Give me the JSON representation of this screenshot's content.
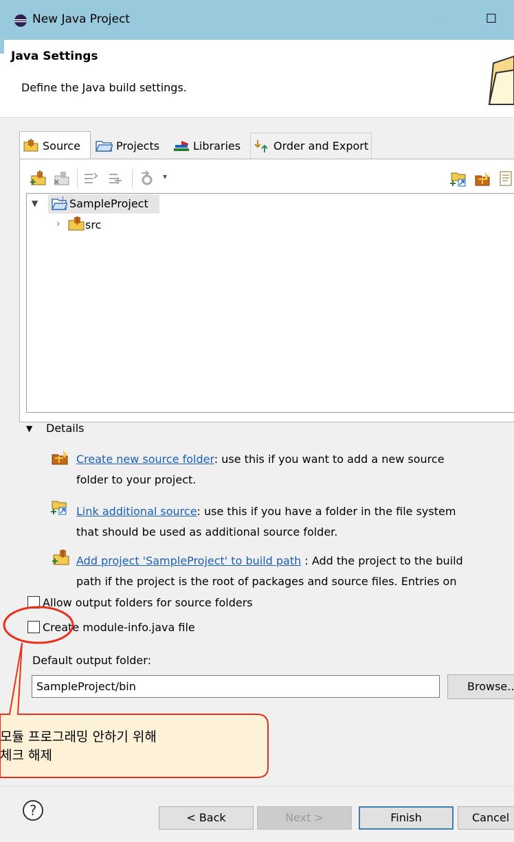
{
  "window": {
    "title": "New Java Project",
    "minimize": "—",
    "maximize": "☐"
  },
  "header": {
    "title": "Java Settings",
    "description": "Define the Java build settings."
  },
  "tabs": [
    {
      "label": "Source",
      "selected": true
    },
    {
      "label": "Projects",
      "selected": false
    },
    {
      "label": "Libraries",
      "selected": false
    },
    {
      "label": "Order and Export",
      "selected": false
    }
  ],
  "tree": {
    "project": "SampleProject",
    "child": "src"
  },
  "details": {
    "label": "Details",
    "items": [
      {
        "link": "Create new source folder",
        "text_1": ": use this if you want to add a new source",
        "text_2": "folder to your project."
      },
      {
        "link": "Link additional source",
        "text_1": ": use this if you have a folder in the file system",
        "text_2": "that should be used as additional source folder."
      },
      {
        "link": "Add project 'SampleProject' to build path",
        "text_1": " : Add the project to the build",
        "text_2": "path if the project is the root of packages and source files. Entries on"
      }
    ]
  },
  "options": {
    "allow_output": "Allow output folders for source folders",
    "module_info": "Create module-info.java file"
  },
  "output": {
    "label": "Default output folder:",
    "value": "SampleProject/bin",
    "browse": "Browse..."
  },
  "buttons": {
    "back": "< Back",
    "next": "Next >",
    "finish": "Finish",
    "cancel": "Cancel"
  },
  "callout": {
    "line1": "모듈 프로그래밍 안하기 위해",
    "line2": "체크 해제"
  },
  "colors": {
    "titlebar": "#99c9dd",
    "link": "#1a5fb4",
    "annotation": "#e8301c",
    "callout_fill": "#fdf2d8"
  }
}
